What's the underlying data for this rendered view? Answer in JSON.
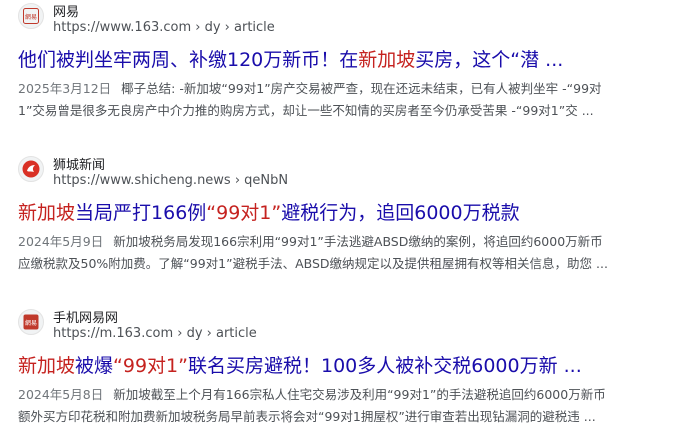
{
  "results": [
    {
      "site_name": "网易",
      "favicon_text": "網易",
      "favicon_color": "#c0392b",
      "url": "https://www.163.com › dy › article",
      "title_parts": [
        {
          "text": "他们被判坐牢两周、补缴120万新币！在",
          "hl": false
        },
        {
          "text": "新加坡",
          "hl": true
        },
        {
          "text": "买房，这个“潜 ...",
          "hl": false
        }
      ],
      "date": "2025年3月12日",
      "snippet_lines": [
        "椰子总结: -新加坡“99对1”房产交易被严查，现在还远未结束，已有人被判坐牢 -“99对",
        "1”交易曾是很多无良房产中介力推的购房方式，却让一些不知情的买房者至今仍承受苦果 -“99对1”交 ..."
      ]
    },
    {
      "site_name": "狮城新闻",
      "favicon_text": "",
      "favicon_color": "#d93025",
      "url": "https://www.shicheng.news › qeNbN",
      "title_parts": [
        {
          "text": "新加坡",
          "hl": true
        },
        {
          "text": "当局严打166例",
          "hl": false
        },
        {
          "text": "“99对1”",
          "hl": true
        },
        {
          "text": "避税行为，追回6000万税款",
          "hl": false
        }
      ],
      "date": "2024年5月9日",
      "snippet_lines": [
        "新加坡税务局发现166宗利用“99对1”手法逃避ABSD缴纳的案例，将追回约6000万新币",
        "应缴税款及50%附加费。了解“99对1”避税手法、ABSD缴纳规定以及提供租屋拥有权等相关信息，助您 ..."
      ]
    },
    {
      "site_name": "手机网易网",
      "favicon_text": "網易",
      "favicon_color": "#c0392b",
      "url": "https://m.163.com › dy › article",
      "title_parts": [
        {
          "text": "新加坡",
          "hl": true
        },
        {
          "text": "被爆",
          "hl": false
        },
        {
          "text": "“99对1”",
          "hl": true
        },
        {
          "text": "联名买房避税！100多人被补交税6000万新 ...",
          "hl": false
        }
      ],
      "date": "2024年5月8日",
      "snippet_lines": [
        "新加坡截至上个月有166宗私人住宅交易涉及利用“99对1”的手法避税追回约6000万新币",
        "额外买方印花税和附加费新加坡税务局早前表示将会对“99对1拥屋权”进行审查若出现钻漏洞的避税违 ..."
      ]
    }
  ]
}
